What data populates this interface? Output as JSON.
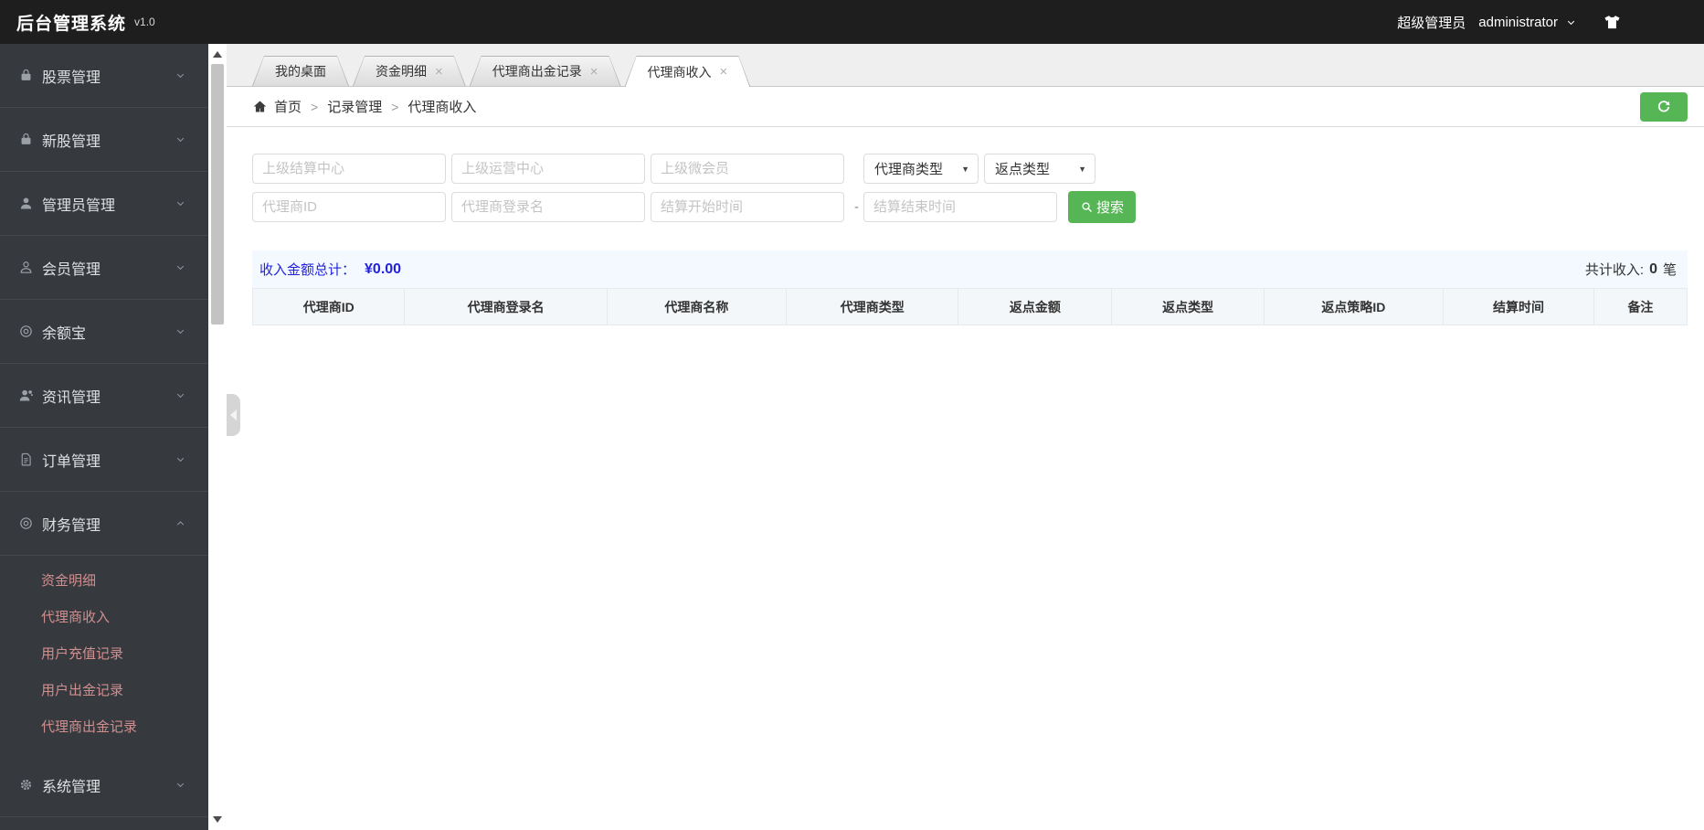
{
  "topbar": {
    "brand": "后台管理系统",
    "version": "v1.0",
    "role": "超级管理员",
    "username": "administrator"
  },
  "sidebar": {
    "items": [
      {
        "label": "股票管理",
        "icon": "briefcase-icon"
      },
      {
        "label": "新股管理",
        "icon": "briefcase-icon"
      },
      {
        "label": "管理员管理",
        "icon": "user-icon"
      },
      {
        "label": "会员管理",
        "icon": "user-outline-icon"
      },
      {
        "label": "余额宝",
        "icon": "target-icon"
      },
      {
        "label": "资讯管理",
        "icon": "user-chat-icon"
      },
      {
        "label": "订单管理",
        "icon": "document-icon"
      },
      {
        "label": "财务管理",
        "icon": "target-icon",
        "expanded": true,
        "children": [
          {
            "label": "资金明细"
          },
          {
            "label": "代理商收入"
          },
          {
            "label": "用户充值记录"
          },
          {
            "label": "用户出金记录"
          },
          {
            "label": "代理商出金记录"
          }
        ]
      },
      {
        "label": "系统管理",
        "icon": "gear-icon"
      }
    ]
  },
  "tabs": [
    {
      "label": "我的桌面"
    },
    {
      "label": "资金明细",
      "close": "×"
    },
    {
      "label": "代理商出金记录",
      "close": "×"
    },
    {
      "label": "代理商收入",
      "close": "×",
      "active": true
    }
  ],
  "breadcrumb": {
    "home": "首页",
    "sep": ">",
    "section": "记录管理",
    "page": "代理商收入"
  },
  "filters": {
    "inputs_row1": [
      {
        "placeholder": "上级结算中心"
      },
      {
        "placeholder": "上级运营中心"
      },
      {
        "placeholder": "上级微会员"
      }
    ],
    "selects": [
      {
        "value": "代理商类型",
        "arrow": "▼"
      },
      {
        "value": "返点类型",
        "arrow": "▼"
      }
    ],
    "inputs_row2": [
      {
        "placeholder": "代理商ID"
      },
      {
        "placeholder": "代理商登录名"
      },
      {
        "placeholder": "结算开始时间"
      },
      {
        "placeholder": "结算结束时间"
      }
    ],
    "range_separator": "-",
    "search_button": "搜索"
  },
  "summary": {
    "income_label": "收入金额总计：",
    "income_value": "¥0.00",
    "count_label": "共计收入:",
    "count_value": "0",
    "count_unit": "笔"
  },
  "table": {
    "columns": [
      "代理商ID",
      "代理商登录名",
      "代理商名称",
      "代理商类型",
      "返点金额",
      "返点类型",
      "返点策略ID",
      "结算时间",
      "备注"
    ],
    "rows": []
  },
  "colors": {
    "accent_green": "#56b656",
    "summary_blue": "#2222dd",
    "submenu_pink": "#d08f8f",
    "topbar_black": "#1e1e1e",
    "sidebar_gray": "#36393e"
  }
}
